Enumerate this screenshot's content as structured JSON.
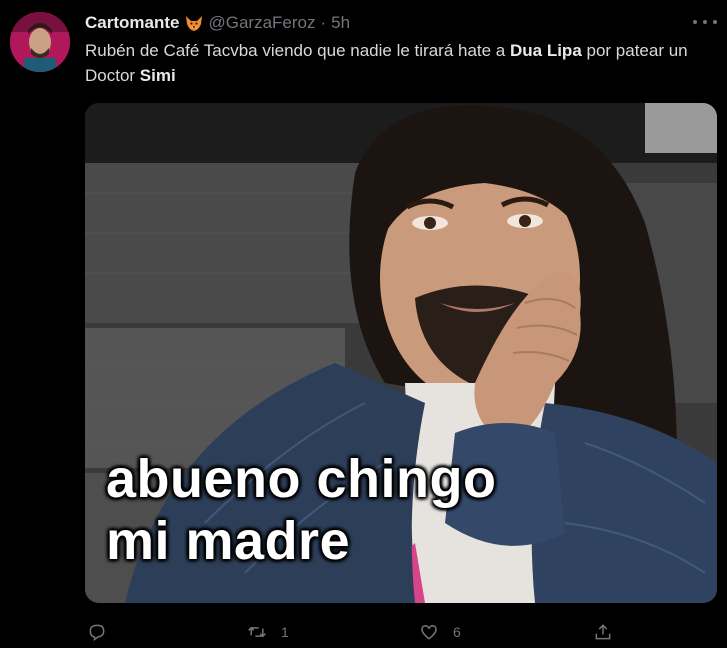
{
  "tweet": {
    "author_name": "Cartomante",
    "author_emoji": "fox-emoji",
    "handle": "@GarzaFeroz",
    "separator": "·",
    "time": "5h",
    "text_part1": "Rubén de Café Tacvba viendo que nadie le tirará hate a ",
    "text_bold1": "Dua Lipa",
    "text_part2": " por patear un Doctor ",
    "text_bold2": "Simi"
  },
  "media": {
    "caption": "abueno chingo\nmi madre"
  },
  "actions": {
    "reply_icon": "reply-icon",
    "retweet_icon": "retweet-icon",
    "retweet_count": "1",
    "like_icon": "heart-icon",
    "like_count": "6",
    "share_icon": "share-icon"
  },
  "colors": {
    "background": "#000000",
    "muted": "#71767b",
    "text": "#d9d9d9"
  }
}
